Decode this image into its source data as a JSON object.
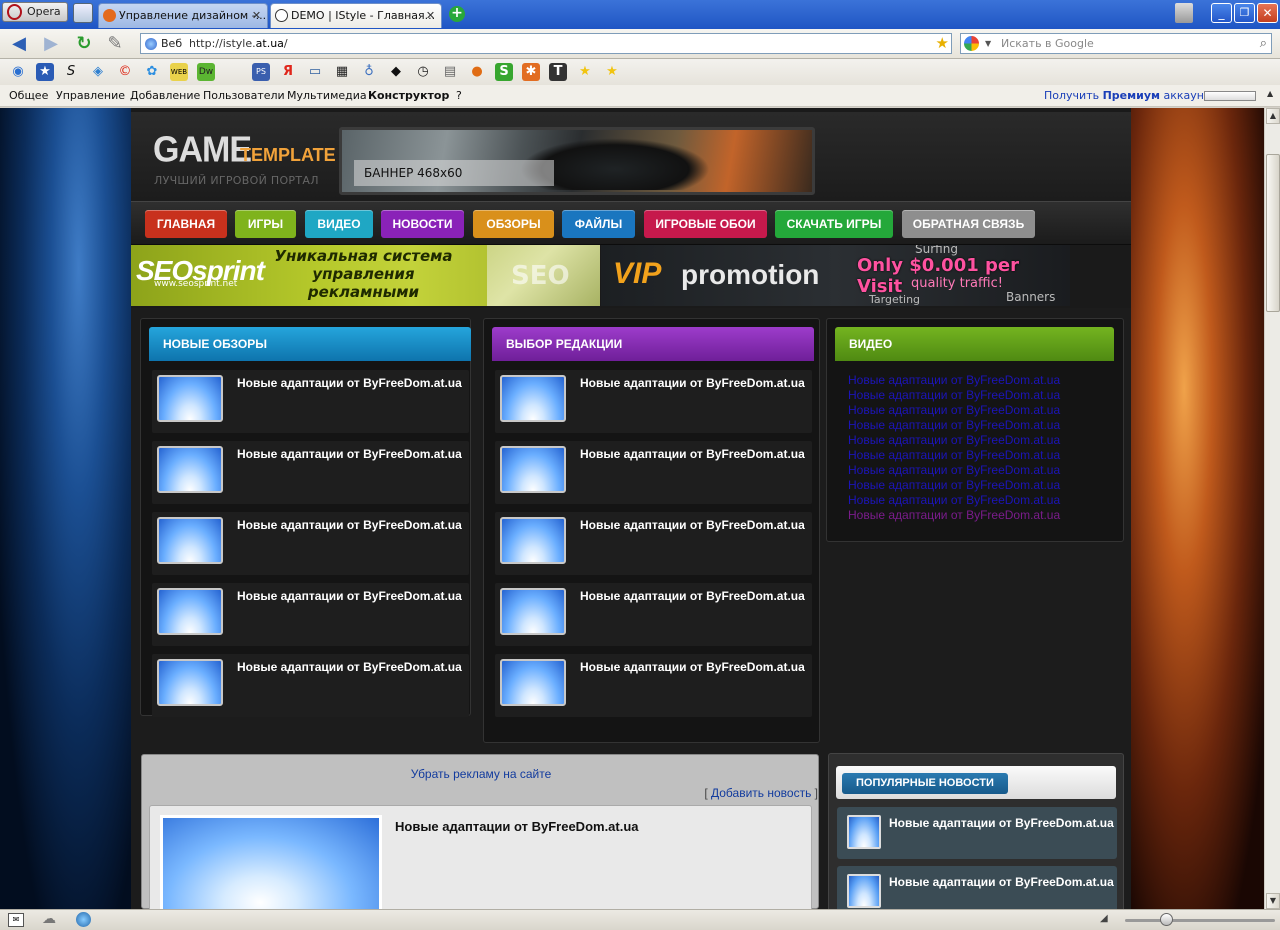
{
  "browser": {
    "opera_label": "Opera",
    "tabs": [
      {
        "title": "Управление дизайном -...",
        "active": false
      },
      {
        "title": "DEMO | IStyle - Главная...",
        "active": true
      }
    ],
    "address": {
      "prefix": "Веб",
      "url_prefix": "http://istyle.",
      "url_domain": "at.ua",
      "url_suffix": "/"
    },
    "search": {
      "placeholder": "Искать в Google"
    },
    "menu": [
      "Общее",
      "Управление",
      "Добавление",
      "Пользователи",
      "Мультимедиа",
      "Конструктор",
      "?"
    ],
    "premium": {
      "pre": "Получить ",
      "bold": "Премиум",
      "post": " аккаунт"
    }
  },
  "site": {
    "logo": {
      "main": "GAME",
      "accent": "TEMPLATE",
      "tagline": "ЛУЧШИЙ ИГРОВОЙ ПОРТАЛ"
    },
    "banner_label": "БАННЕР 468x60",
    "nav": [
      {
        "label": "ГЛАВНАЯ",
        "color": "#c8311d"
      },
      {
        "label": "ИГРЫ",
        "color": "#7fb31c"
      },
      {
        "label": "ВИДЕО",
        "color": "#1fa7c4"
      },
      {
        "label": "НОВОСТИ",
        "color": "#8a22b8"
      },
      {
        "label": "ОБЗОРЫ",
        "color": "#d9901b"
      },
      {
        "label": "ФАЙЛЫ",
        "color": "#1a76bf"
      },
      {
        "label": "ИГРОВЫЕ ОБОИ",
        "color": "#c6194c"
      },
      {
        "label": "СКАЧАТЬ ИГРЫ",
        "color": "#24a83a"
      },
      {
        "label": "ОБРАТНАЯ СВЯЗЬ",
        "color": "#8e8e8e"
      }
    ],
    "ads": {
      "seo": {
        "brand": "SEOsprint",
        "url": "www.seosprint.net",
        "text": "Уникальная система управления рекламными кампаниями",
        "img_word": "SEO"
      },
      "vip": {
        "vip": "VIP",
        "promotion": "promotion",
        "price": "Only $0.001 per Visit",
        "quality": "quality traffic!",
        "w1": "Surfing",
        "w2": "Targeting",
        "w3": "Banners"
      }
    },
    "columns": [
      {
        "title": "НОВЫЕ ОБЗОРЫ",
        "color": "#1a8bc3",
        "items": [
          "Новые адаптации от ByFreeDom.at.ua",
          "Новые адаптации от ByFreeDom.at.ua",
          "Новые адаптации от ByFreeDom.at.ua",
          "Новые адаптации от ByFreeDom.at.ua",
          "Новые адаптации от ByFreeDom.at.ua"
        ]
      },
      {
        "title": "ВЫБОР РЕДАКЦИИ",
        "color": "#8b2bb6",
        "items": [
          "Новые адаптации от ByFreeDom.at.ua",
          "Новые адаптации от ByFreeDom.at.ua",
          "Новые адаптации от ByFreeDom.at.ua",
          "Новые адаптации от ByFreeDom.at.ua",
          "Новые адаптации от ByFreeDom.at.ua"
        ]
      }
    ],
    "video": {
      "title": "ВИДЕО",
      "color": "#5f9a17",
      "links": [
        "Новые адаптации от ByFreeDom.at.ua",
        "Новые адаптации от ByFreeDom.at.ua",
        "Новые адаптации от ByFreeDom.at.ua",
        "Новые адаптации от ByFreeDom.at.ua",
        "Новые адаптации от ByFreeDom.at.ua",
        "Новые адаптации от ByFreeDom.at.ua",
        "Новые адаптации от ByFreeDom.at.ua",
        "Новые адаптации от ByFreeDom.at.ua",
        "Новые адаптации от ByFreeDom.at.ua",
        "Новые адаптации от ByFreeDom.at.ua"
      ]
    },
    "main": {
      "remove_ads": "Убрать рекламу на сайте",
      "add_news": "Добавить новость",
      "bracket_open": "[ ",
      "bracket_close": " ]",
      "post_title": "Новые адаптации от ByFreeDom.at.ua"
    },
    "popular": {
      "title": "ПОПУЛЯРНЫЕ НОВОСТИ",
      "items": [
        "Новые адаптации от ByFreeDom.at.ua",
        "Новые адаптации от ByFreeDom.at.ua"
      ]
    }
  }
}
